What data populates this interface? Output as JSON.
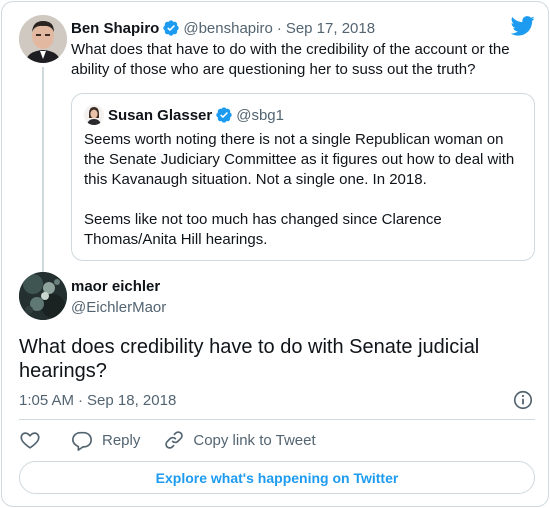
{
  "colors": {
    "accent": "#1d9bf0",
    "verified": "#1d9bf0",
    "secondary_text": "#536471",
    "border": "#cfd9de"
  },
  "parent_tweet": {
    "author_name": "Ben Shapiro",
    "handle": "@benshapiro",
    "separator": "·",
    "date": "Sep 17, 2018",
    "text": "What does that have to do with the credibility of the account or the ability of those who are questioning her to suss out the truth?",
    "verified_icon": "verified-badge-icon"
  },
  "quoted_tweet": {
    "author_name": "Susan Glasser",
    "handle": "@sbg1",
    "paragraph_1": "Seems worth noting there is not a single Republican woman on the Senate Judiciary Committee as it figures out how to deal with this Kavanaugh situation. Not a single one. In 2018.",
    "paragraph_2": "Seems like not too much has changed since Clarence Thomas/Anita Hill hearings."
  },
  "main_tweet": {
    "author_name": "maor eichler",
    "handle": "@EichlerMaor",
    "text": "What does credibility have to do with Senate judicial hearings?",
    "time": "1:05 AM",
    "separator": "·",
    "date": "Sep 18, 2018"
  },
  "actions": {
    "like_icon": "heart-icon",
    "reply_label": "Reply",
    "copy_label": "Copy link to Tweet"
  },
  "footer": {
    "explore_label": "Explore what's happening on Twitter"
  },
  "icons": {
    "brand": "twitter-bird-icon",
    "info": "info-icon"
  }
}
